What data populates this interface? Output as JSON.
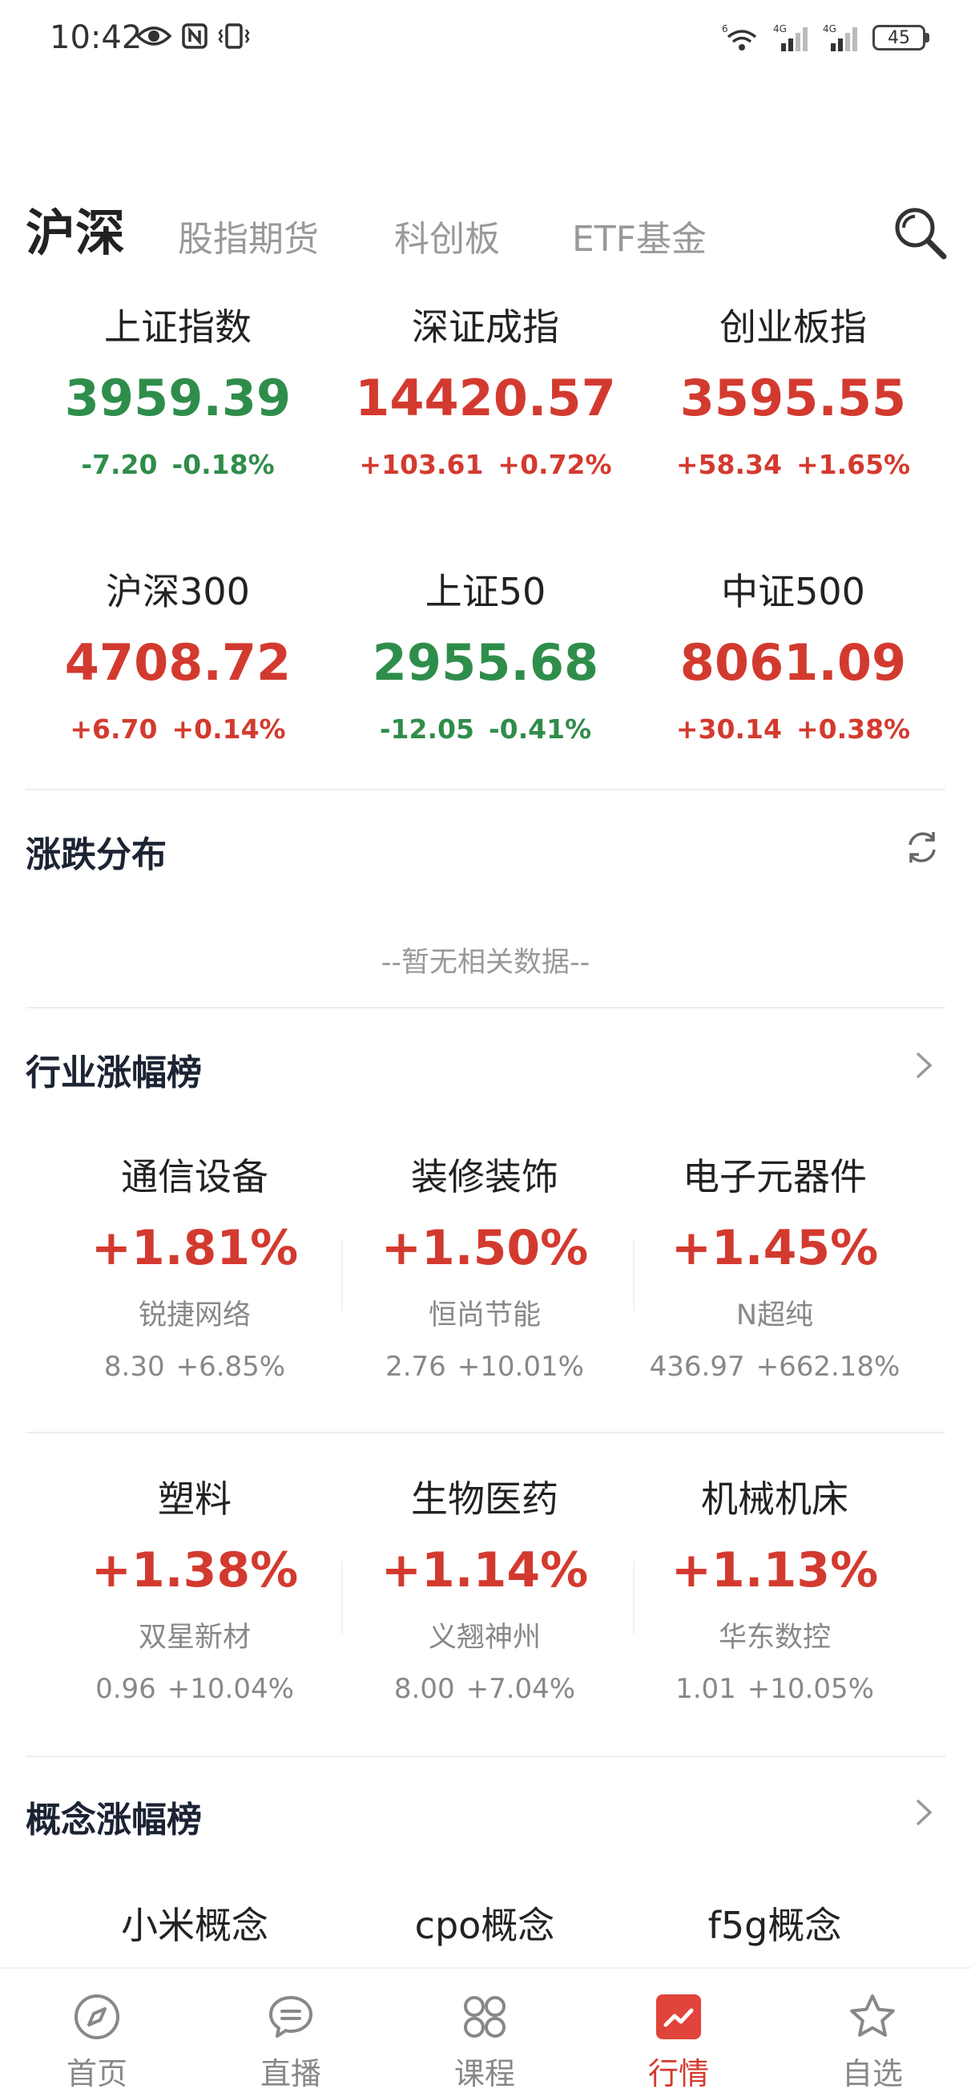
{
  "status_bar": {
    "time": "10:42",
    "network_1": "6",
    "network_2": "4G",
    "network_3": "4G",
    "battery": "45"
  },
  "tabs": {
    "active": "沪深",
    "items": [
      "股指期货",
      "科创板",
      "ETF基金"
    ]
  },
  "indices": [
    {
      "name": "上证指数",
      "value": "3959.39",
      "change": "-7.20",
      "percent": "-0.18%",
      "trend": "down"
    },
    {
      "name": "深证成指",
      "value": "14420.57",
      "change": "+103.61",
      "percent": "+0.72%",
      "trend": "up"
    },
    {
      "name": "创业板指",
      "value": "3595.55",
      "change": "+58.34",
      "percent": "+1.65%",
      "trend": "up"
    },
    {
      "name": "沪深300",
      "value": "4708.72",
      "change": "+6.70",
      "percent": "+0.14%",
      "trend": "up"
    },
    {
      "name": "上证50",
      "value": "2955.68",
      "change": "-12.05",
      "percent": "-0.41%",
      "trend": "down"
    },
    {
      "name": "中证500",
      "value": "8061.09",
      "change": "+30.14",
      "percent": "+0.38%",
      "trend": "up"
    }
  ],
  "distribution": {
    "title": "涨跌分布",
    "empty_text": "--暂无相关数据--"
  },
  "industry": {
    "title": "行业涨幅榜",
    "items": [
      {
        "name": "通信设备",
        "change": "+1.81%",
        "stock": "锐捷网络",
        "price": "8.30",
        "stock_change": "+6.85%"
      },
      {
        "name": "装修装饰",
        "change": "+1.50%",
        "stock": "恒尚节能",
        "price": "2.76",
        "stock_change": "+10.01%"
      },
      {
        "name": "电子元器件",
        "change": "+1.45%",
        "stock": "N超纯",
        "price": "436.97",
        "stock_change": "+662.18%"
      },
      {
        "name": "塑料",
        "change": "+1.38%",
        "stock": "双星新材",
        "price": "0.96",
        "stock_change": "+10.04%"
      },
      {
        "name": "生物医药",
        "change": "+1.14%",
        "stock": "义翘神州",
        "price": "8.00",
        "stock_change": "+7.04%"
      },
      {
        "name": "机械机床",
        "change": "+1.13%",
        "stock": "华东数控",
        "price": "1.01",
        "stock_change": "+10.05%"
      }
    ]
  },
  "concept": {
    "title": "概念涨幅榜",
    "items": [
      {
        "name": "小米概念"
      },
      {
        "name": "cpo概念"
      },
      {
        "name": "f5g概念"
      }
    ]
  },
  "bottom_nav": [
    {
      "label": "首页",
      "icon": "compass-icon"
    },
    {
      "label": "直播",
      "icon": "chat-bubble-icon"
    },
    {
      "label": "课程",
      "icon": "grid-icon"
    },
    {
      "label": "行情",
      "icon": "chart-icon"
    },
    {
      "label": "自选",
      "icon": "star-icon"
    }
  ],
  "colors": {
    "up": "#d33a2f",
    "down": "#2f8d4b",
    "accent": "#e0443a"
  }
}
